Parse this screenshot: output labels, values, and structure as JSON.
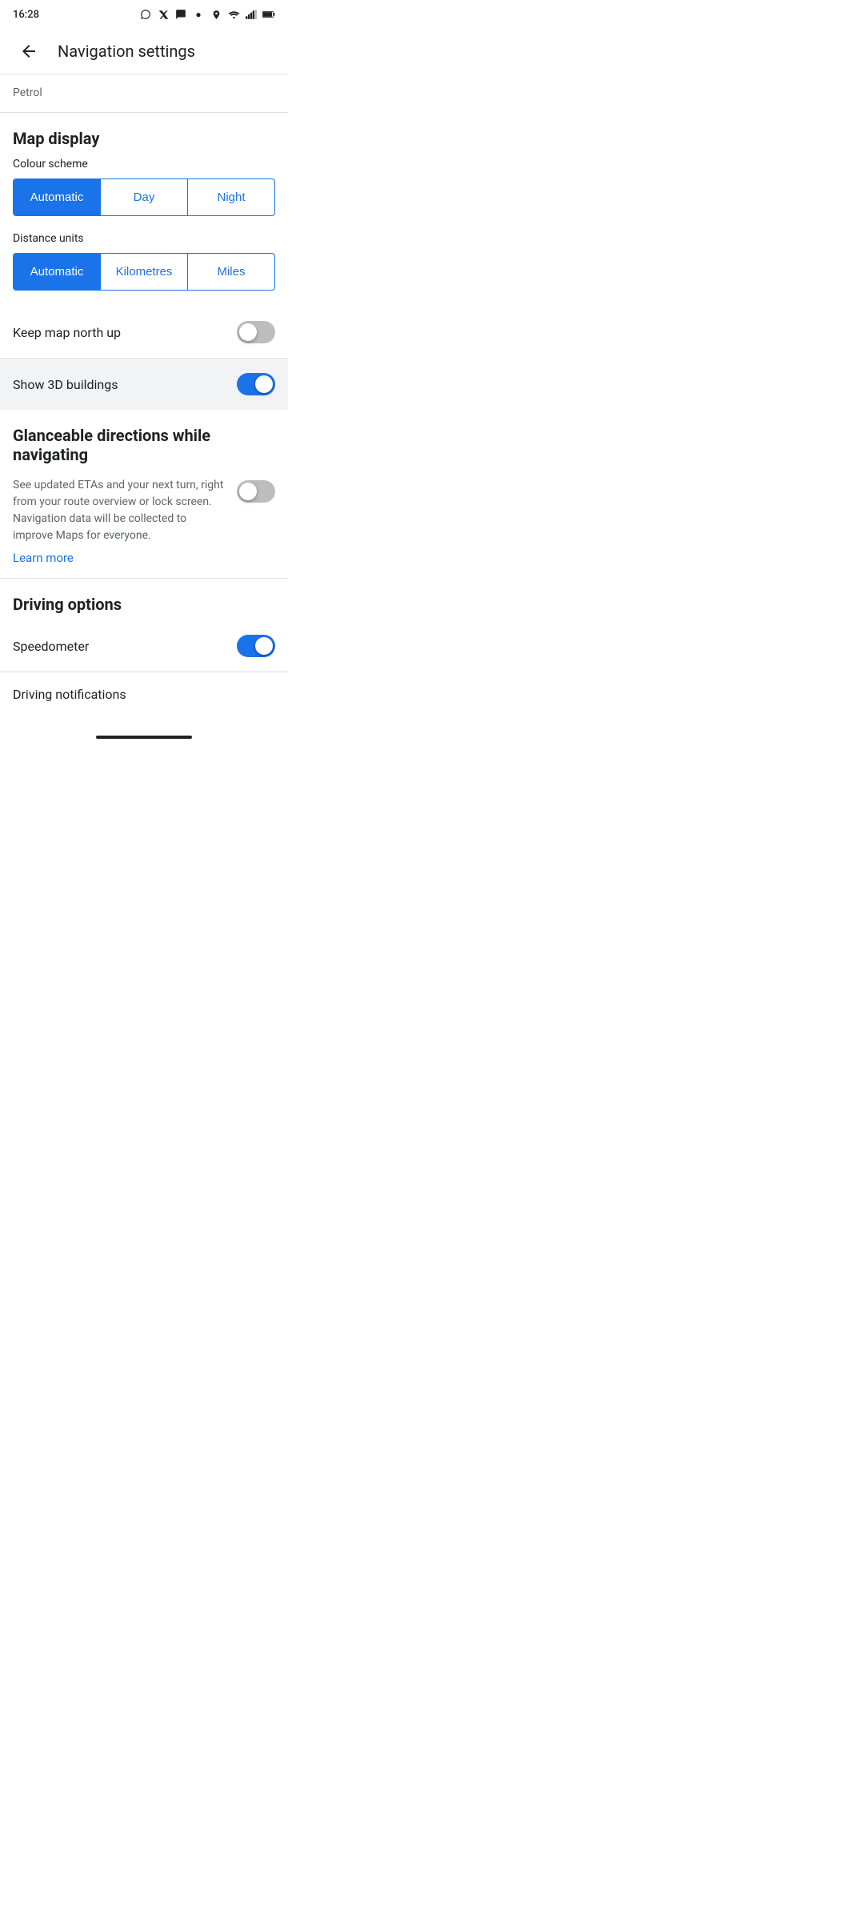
{
  "statusBar": {
    "time": "16:28",
    "icons": [
      "whatsapp",
      "x",
      "chat",
      "dot",
      "location",
      "wifi",
      "signal",
      "battery"
    ]
  },
  "appBar": {
    "backLabel": "←",
    "title": "Navigation settings"
  },
  "petrol": {
    "label": "Petrol"
  },
  "mapDisplay": {
    "sectionTitle": "Map display",
    "colourScheme": {
      "label": "Colour scheme",
      "options": [
        "Automatic",
        "Day",
        "Night"
      ],
      "selected": "Automatic"
    },
    "distanceUnits": {
      "label": "Distance units",
      "options": [
        "Automatic",
        "Kilometres",
        "Miles"
      ],
      "selected": "Automatic"
    },
    "keepMapNorthUp": {
      "label": "Keep map north up",
      "enabled": false
    },
    "show3DBuildings": {
      "label": "Show 3D buildings",
      "enabled": true
    }
  },
  "glanceable": {
    "title": "Glanceable directions while navigating",
    "description": "See updated ETAs and your next turn, right from your route overview or lock screen. Navigation data will be collected to improve Maps for everyone.",
    "enabled": false,
    "learnMore": "Learn more"
  },
  "drivingOptions": {
    "sectionTitle": "Driving options",
    "speedometer": {
      "label": "Speedometer",
      "enabled": true
    },
    "drivingNotifications": {
      "label": "Driving notifications"
    }
  }
}
